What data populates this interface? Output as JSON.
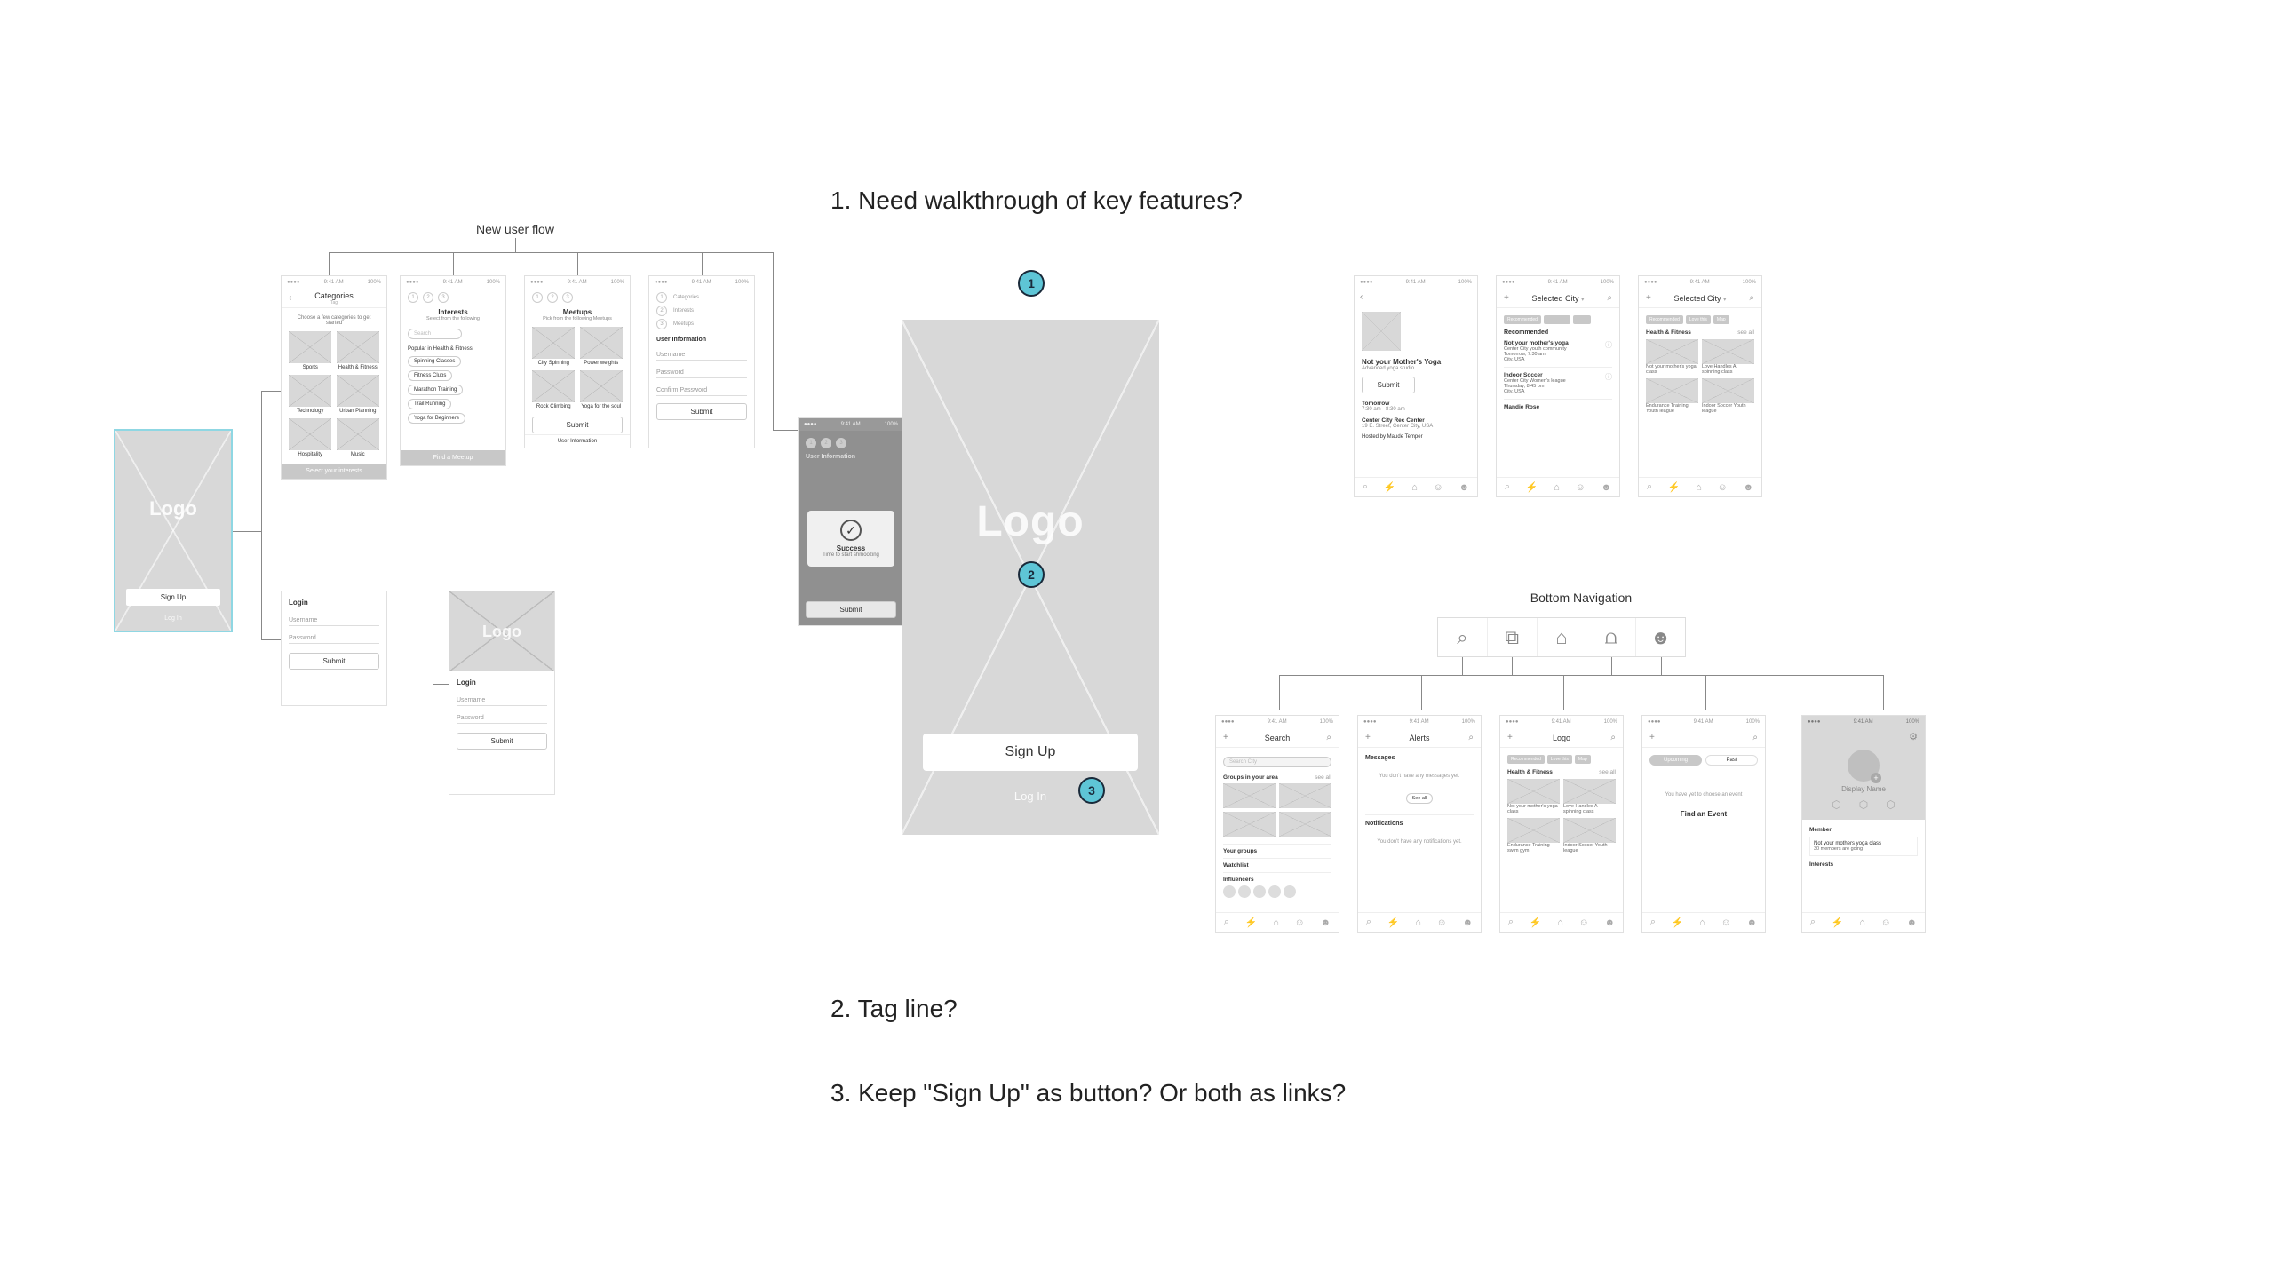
{
  "questions": {
    "q1": "1. Need walkthrough of key features?",
    "q2": "2. Tag line?",
    "q3": "3. Keep \"Sign Up\" as button? Or both as links?"
  },
  "badges": {
    "b1": "1",
    "b2": "2",
    "b3": "3"
  },
  "sections": {
    "newUserFlow": "New user flow",
    "bottomNav": "Bottom Navigation"
  },
  "startScreen": {
    "logo": "Logo",
    "signUp": "Sign Up",
    "logIn": "Log In"
  },
  "bigLanding": {
    "logo": "Logo",
    "signUp": "Sign Up",
    "logIn": "Log In"
  },
  "categories": {
    "title": "Categories",
    "tag": "Tag",
    "prompt": "Choose a few categories to get started",
    "items": [
      "Sports",
      "Health & Fitness",
      "Technology",
      "Urban Planning",
      "Hospitality",
      "Music"
    ],
    "cta": "Select your interests"
  },
  "interests": {
    "title": "Interests",
    "subtitle": "Select from the following",
    "searchPlaceholder": "Search",
    "groupHeader": "Popular in Health & Fitness",
    "items": [
      "Spinning Classes",
      "Fitness Clubs",
      "Marathon Training",
      "Trail Running",
      "Yoga for Beginners"
    ],
    "cta": "Find a Meetup"
  },
  "meetups": {
    "title": "Meetups",
    "subtitle": "Pick from the following Meetups",
    "items": [
      "City Spinning",
      "Power weights",
      "Rock Climbing",
      "Yoga for the soul"
    ],
    "cta": "Submit"
  },
  "userInfo": {
    "stepLabels": [
      "Categories",
      "Interests",
      "Meetups"
    ],
    "heading": "User Information",
    "fields": [
      "Username",
      "Password",
      "Confirm Password"
    ],
    "cta": "Submit"
  },
  "successModal": {
    "heading": "User Information",
    "title": "Success",
    "subtitle": "Time to start shmoozing",
    "cta": "Submit"
  },
  "login1": {
    "heading": "Login",
    "username": "Username",
    "password": "Password",
    "cta": "Submit"
  },
  "login2": {
    "logo": "Logo",
    "heading": "Login",
    "username": "Username",
    "password": "Password",
    "cta": "Submit"
  },
  "detail": {
    "title": "Not your Mother's Yoga",
    "subtitle": "Advanced yoga studio",
    "cta": "Submit",
    "when": "Tomorrow",
    "time": "7:30 am - 8:30 am",
    "venue": "Center City Rec Center",
    "address": "19 E. Street, Center City, USA",
    "host": "Hosted by Maude Temper"
  },
  "recommended": {
    "header": "Selected City",
    "tags": [
      "Recommended",
      "",
      ""
    ],
    "sectionTitle": "Recommended",
    "items": [
      {
        "title": "Not your mother's yoga",
        "sub": "Center City youth community",
        "when": "Tomorrow, 7:30 am",
        "where": "City, USA"
      },
      {
        "title": "Indoor Soccer",
        "sub": "Center City Women's league",
        "when": "Thursday, 8:45 pm",
        "where": "City, USA"
      },
      {
        "title": "Mandie Rose",
        "sub": "",
        "when": "",
        "where": ""
      }
    ]
  },
  "browse": {
    "header": "Selected City",
    "tags": [
      "Recommended",
      "Love this",
      "Map"
    ],
    "section": "Health & Fitness",
    "seeAll": "see all",
    "items": [
      {
        "t": "Not your mother's yoga class"
      },
      {
        "t": "Love Handles\nA spinning class"
      },
      {
        "t": "Endurance Training\nYouth league"
      },
      {
        "t": "Indoor Soccer\nYouth league"
      }
    ]
  },
  "navBar": {
    "icons": [
      "search",
      "bolt",
      "home",
      "group",
      "profile"
    ]
  },
  "search": {
    "title": "Search",
    "placeholder": "Search City",
    "s1": "Groups in your area",
    "seeAll": "see all",
    "s2": "Your groups",
    "s3": "Watchlist",
    "s4": "Influencers"
  },
  "alerts": {
    "title": "Alerts",
    "messages": "Messages",
    "emptyMsg": "You don't have any messages yet.",
    "seeAll": "See all",
    "notifications": "Notifications",
    "emptyNotif": "You don't have any notifications yet."
  },
  "home": {
    "title": "Logo",
    "tags": [
      "Recommended",
      "Love this",
      "Map"
    ],
    "section": "Health & Fitness",
    "seeAll": "see all",
    "items": [
      {
        "t": "Not your mother's yoga class"
      },
      {
        "t": "Love Handles\nA spinning class"
      },
      {
        "t": "Endurance Training\nswim gym"
      },
      {
        "t": "Indoor Soccer\nYouth league"
      }
    ]
  },
  "events": {
    "tabs": [
      "Upcoming",
      "Past"
    ],
    "empty": "You have yet to choose an event",
    "cta": "Find an Event"
  },
  "profile": {
    "name": "Display Name",
    "memberHeading": "Member",
    "memberOf": "Not your mothers yoga class",
    "memberMeta": "30 members are going",
    "interestsHeading": "Interests"
  },
  "statusBar": {
    "time": "9:41 AM",
    "battery": "100%"
  }
}
